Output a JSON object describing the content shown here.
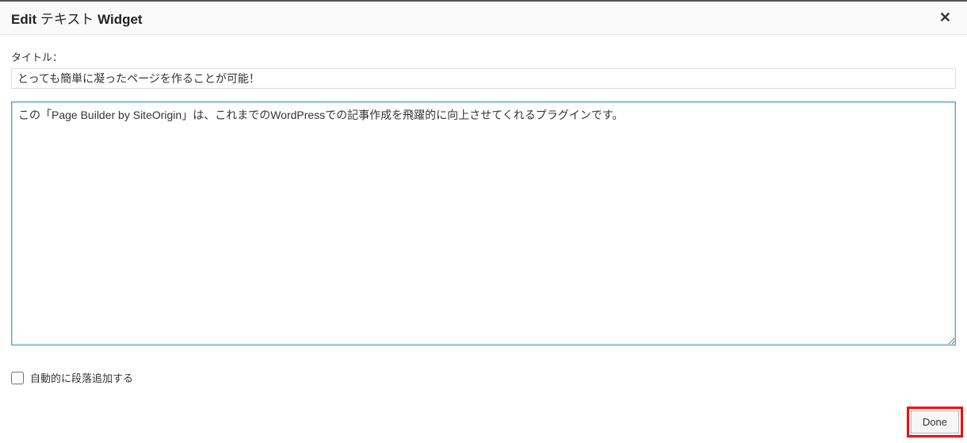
{
  "modal": {
    "title_prefix": "Edit",
    "title_middle": "テキスト",
    "title_suffix": "Widget",
    "close_symbol": "✕"
  },
  "form": {
    "title_label": "タイトル：",
    "title_value": "とっても簡単に凝ったページを作ることが可能！",
    "content_value": "この「Page Builder by SiteOrigin」は、これまでのWordPressでの記事作成を飛躍的に向上させてくれるプラグインです。",
    "auto_paragraph_label": "自動的に段落追加する"
  },
  "footer": {
    "done_label": "Done"
  }
}
